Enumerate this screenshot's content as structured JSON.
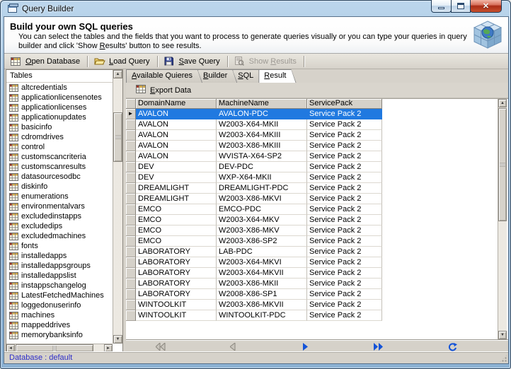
{
  "window": {
    "title": "Query Builder"
  },
  "header": {
    "title": "Build your own SQL queries",
    "description_pre": "You can select the tables and the fields that you want to process to generate queries visually or you can type your queries in query builder and click 'Show ",
    "description_accel": "R",
    "description_post": "esults' button to see results."
  },
  "toolbar": {
    "buttons": [
      {
        "pre": "",
        "accel": "O",
        "rest": "pen Database",
        "icon": "database-table-icon",
        "enabled": true
      },
      {
        "pre": "",
        "accel": "L",
        "rest": "oad Query",
        "icon": "open-folder-icon",
        "enabled": true
      },
      {
        "pre": "",
        "accel": "S",
        "rest": "ave Query",
        "icon": "save-icon",
        "enabled": true
      },
      {
        "pre": "Show ",
        "accel": "R",
        "rest": "esults",
        "icon": "preview-icon",
        "enabled": false
      }
    ]
  },
  "tables_panel": {
    "header": "Tables",
    "items": [
      "altcredentials",
      "applicationlicensenotes",
      "applicationlicenses",
      "applicationupdates",
      "basicinfo",
      "cdromdrives",
      "control",
      "customscancriteria",
      "customscanresults",
      "datasourcesodbc",
      "diskinfo",
      "enumerations",
      "environmentalvars",
      "excludedinstapps",
      "excludedips",
      "excludedmachines",
      "fonts",
      "installedapps",
      "installedappsgroups",
      "installedappslist",
      "instappschangelog",
      "LatestFetchedMachines",
      "loggedonuserinfo",
      "machines",
      "mappeddrives",
      "memorybanksinfo"
    ]
  },
  "tabs": [
    {
      "pre": "",
      "accel": "A",
      "rest": "vailable Quieres",
      "active": false
    },
    {
      "pre": "",
      "accel": "B",
      "rest": "uilder",
      "active": false
    },
    {
      "pre": "",
      "accel": "S",
      "rest": "QL",
      "active": false
    },
    {
      "pre": "",
      "accel": "R",
      "rest": "esult",
      "active": true
    }
  ],
  "result_toolbar": {
    "export_pre": "",
    "export_accel": "E",
    "export_rest": "xport Data"
  },
  "grid": {
    "columns": [
      "DomainName",
      "MachineName",
      "ServicePack"
    ],
    "selected_row": 0,
    "rows": [
      [
        "AVALON",
        "AVALON-PDC",
        "Service Pack 2"
      ],
      [
        "AVALON",
        "W2003-X64-MKII",
        "Service Pack 2"
      ],
      [
        "AVALON",
        "W2003-X64-MKIII",
        "Service Pack 2"
      ],
      [
        "AVALON",
        "W2003-X86-MKIII",
        "Service Pack 2"
      ],
      [
        "AVALON",
        "WVISTA-X64-SP2",
        "Service Pack 2"
      ],
      [
        "DEV",
        "DEV-PDC",
        "Service Pack 2"
      ],
      [
        "DEV",
        "WXP-X64-MKII",
        "Service Pack 2"
      ],
      [
        "DREAMLIGHT",
        "DREAMLIGHT-PDC",
        "Service Pack 2"
      ],
      [
        "DREAMLIGHT",
        "W2003-X86-MKVI",
        "Service Pack 2"
      ],
      [
        "EMCO",
        "EMCO-PDC",
        "Service Pack 2"
      ],
      [
        "EMCO",
        "W2003-X64-MKV",
        "Service Pack 2"
      ],
      [
        "EMCO",
        "W2003-X86-MKV",
        "Service Pack 2"
      ],
      [
        "EMCO",
        "W2003-X86-SP2",
        "Service Pack 2"
      ],
      [
        "LABORATORY",
        "LAB-PDC",
        "Service Pack 2"
      ],
      [
        "LABORATORY",
        "W2003-X64-MKVI",
        "Service Pack 2"
      ],
      [
        "LABORATORY",
        "W2003-X64-MKVII",
        "Service Pack 2"
      ],
      [
        "LABORATORY",
        "W2003-X86-MKII",
        "Service Pack 2"
      ],
      [
        "LABORATORY",
        "W2008-X86-SP1",
        "Service Pack 2"
      ],
      [
        "WINTOOLKIT",
        "W2003-X86-MKVII",
        "Service Pack 2"
      ],
      [
        "WINTOOLKIT",
        "WINTOOLKIT-PDC",
        "Service Pack 2"
      ]
    ]
  },
  "pager": {
    "buttons": [
      "first-page",
      "previous-page",
      "next-page",
      "last-page",
      "refresh"
    ]
  },
  "status_bar": {
    "text": "Database : default"
  },
  "colors": {
    "selection": "#2079e0",
    "status_text": "#2e2ec8",
    "pager_active": "#1353d8",
    "pager_disabled": "#c8c4bc",
    "titlebar": "#8fb8dc"
  }
}
